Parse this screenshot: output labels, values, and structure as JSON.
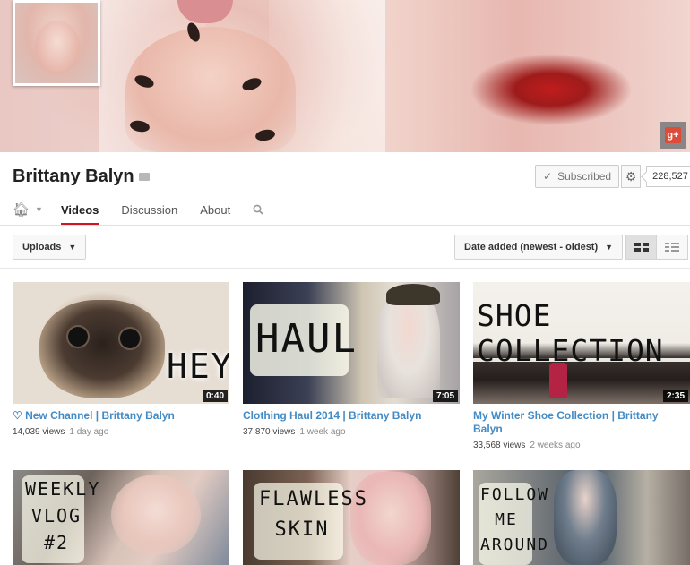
{
  "channel": {
    "name": "Brittany Balyn",
    "subscribe_label": "Subscribed",
    "subscriber_count": "228,527"
  },
  "banner": {
    "gplus_label": "g+"
  },
  "tabs": {
    "items": [
      {
        "label": "Videos",
        "active": true
      },
      {
        "label": "Discussion",
        "active": false
      },
      {
        "label": "About",
        "active": false
      }
    ]
  },
  "toolbar": {
    "uploads_label": "Uploads",
    "sort_label": "Date added (newest - oldest)"
  },
  "videos": [
    {
      "title": "♡ New Channel | Brittany Balyn",
      "views": "14,039 views",
      "age": "1 day ago",
      "duration": "0:40",
      "thumb_text": "HEY!"
    },
    {
      "title": "Clothing Haul 2014 | Brittany Balyn",
      "views": "37,870 views",
      "age": "1 week ago",
      "duration": "7:05",
      "thumb_text": "HAUL"
    },
    {
      "title": "My Winter Shoe Collection | Brittany Balyn",
      "views": "33,568 views",
      "age": "2 weeks ago",
      "duration": "2:35",
      "thumb_text": "SHOE COLLECTION"
    },
    {
      "title": "",
      "views": "",
      "age": "",
      "duration": "",
      "thumb_text": "WEEKLY VLOG #2"
    },
    {
      "title": "",
      "views": "",
      "age": "",
      "duration": "",
      "thumb_text": "FLAWLESS SKIN"
    },
    {
      "title": "",
      "views": "",
      "age": "",
      "duration": "",
      "thumb_text": "FOLLOW ME AROUND"
    }
  ],
  "icons": {
    "home": "home-icon",
    "search": "search-icon",
    "gear": "gear-icon",
    "check": "check-icon",
    "grid": "grid-view-icon",
    "list": "list-view-icon"
  },
  "colors": {
    "accent": "#cc181e",
    "link": "#438bc5",
    "gplus": "#dd4b39"
  }
}
